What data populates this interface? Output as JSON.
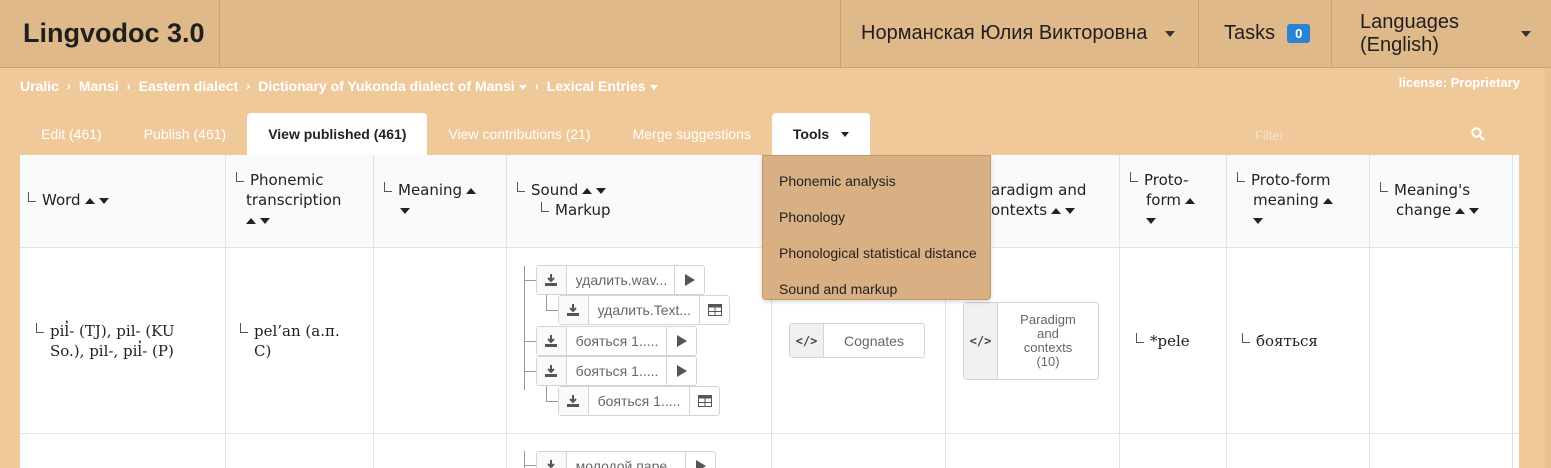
{
  "app": {
    "title": "Lingvodoc 3.0"
  },
  "header": {
    "user": "Норманская Юлия Викторовна",
    "tasks_label": "Tasks",
    "tasks_count": "0",
    "languages_label": "Languages (English)"
  },
  "breadcrumb": {
    "items": [
      "Uralic",
      "Mansi",
      "Eastern dialect",
      "Dictionary of Yukonda dialect of Mansi",
      "Lexical Entries"
    ]
  },
  "license": "license: Proprietary",
  "tabs": [
    {
      "label": "Edit (461)"
    },
    {
      "label": "Publish (461)"
    },
    {
      "label": "View published (461)"
    },
    {
      "label": "View contributions (21)"
    },
    {
      "label": "Merge suggestions"
    },
    {
      "label": "Tools"
    }
  ],
  "filter": {
    "placeholder": "Filter"
  },
  "tools_menu": [
    "Phonemic analysis",
    "Phonology",
    "Phonological statistical distance",
    "Sound and markup"
  ],
  "columns": {
    "word": "Word",
    "phonemic_1": "Phonemic",
    "phonemic_2": "transcription",
    "meaning": "Meaning",
    "sound": "Sound",
    "markup": "Markup",
    "paradigm_1": "aradigm and",
    "paradigm_2": "ontexts",
    "protoform_1": "Proto-",
    "protoform_2": "form",
    "protomeaning_1": "Proto-form",
    "protomeaning_2": "meaning",
    "change_1": "Meaning's",
    "change_2": "change"
  },
  "row1": {
    "word_1": "pil̓- (TJ), pil- (KU",
    "word_2": "So.), pil-, pil̓- (P)",
    "phonemic_1": "pel’an (а.п.",
    "phonemic_2": "С)",
    "sounds": [
      "удалить.wav...",
      "удалить.Text...",
      "бояться 1.....",
      "бояться 1.....",
      "бояться 1....."
    ],
    "cognates": "Cognates",
    "paradigm": "Paradigm and contexts (10)",
    "protoform": "*pele",
    "protomeaning": "бояться"
  },
  "row2": {
    "sound": "молодой парe..."
  }
}
